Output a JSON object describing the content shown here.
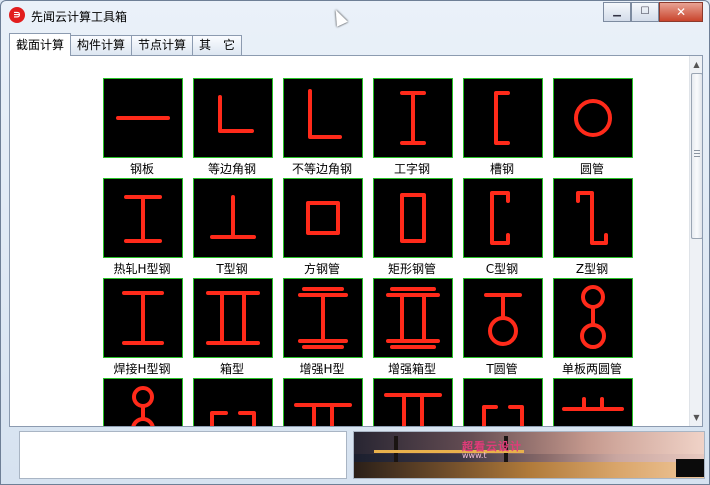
{
  "window": {
    "title": "先闻云计算工具箱",
    "app_icon_glyph": "∍",
    "controls": {
      "minimize": "▁",
      "maximize": "☐",
      "close": "✕"
    }
  },
  "tabs": [
    {
      "label": "截面计算",
      "active": true
    },
    {
      "label": "构件计算",
      "active": false
    },
    {
      "label": "节点计算",
      "active": false
    },
    {
      "label": "其　它",
      "active": false
    }
  ],
  "sections": [
    {
      "label": "钢板",
      "icon": "plate-icon"
    },
    {
      "label": "等边角钢",
      "icon": "equal-angle-icon"
    },
    {
      "label": "不等边角钢",
      "icon": "unequal-angle-icon"
    },
    {
      "label": "工字钢",
      "icon": "i-beam-icon"
    },
    {
      "label": "槽钢",
      "icon": "channel-icon"
    },
    {
      "label": "圆管",
      "icon": "round-tube-icon"
    },
    {
      "label": "热轧H型钢",
      "icon": "hot-rolled-h-icon"
    },
    {
      "label": "T型钢",
      "icon": "t-section-icon"
    },
    {
      "label": "方钢管",
      "icon": "square-tube-icon"
    },
    {
      "label": "矩形钢管",
      "icon": "rect-tube-icon"
    },
    {
      "label": "C型钢",
      "icon": "c-section-icon"
    },
    {
      "label": "Z型钢",
      "icon": "z-section-icon"
    },
    {
      "label": "焊接H型钢",
      "icon": "welded-h-icon"
    },
    {
      "label": "箱型",
      "icon": "box-section-icon"
    },
    {
      "label": "增强H型",
      "icon": "reinforced-h-icon"
    },
    {
      "label": "增强箱型",
      "icon": "reinforced-box-icon"
    },
    {
      "label": "T圆管",
      "icon": "t-round-tube-icon"
    },
    {
      "label": "单板两圆管",
      "icon": "plate-two-tubes-icon"
    },
    {
      "label": "",
      "icon": "tube-plate-tube-icon"
    },
    {
      "label": "",
      "icon": "double-channel-icon"
    },
    {
      "label": "",
      "icon": "double-t-icon"
    },
    {
      "label": "",
      "icon": "double-t-b-icon"
    },
    {
      "label": "",
      "icon": "double-channel-b-icon"
    },
    {
      "label": "",
      "icon": "double-lip-icon"
    }
  ],
  "banner": {
    "text": "超看云设计",
    "subtext": "www.t"
  },
  "colors": {
    "shape_stroke": "#ff2a1a",
    "thumb_border": "#27c227",
    "thumb_bg": "#000000"
  }
}
